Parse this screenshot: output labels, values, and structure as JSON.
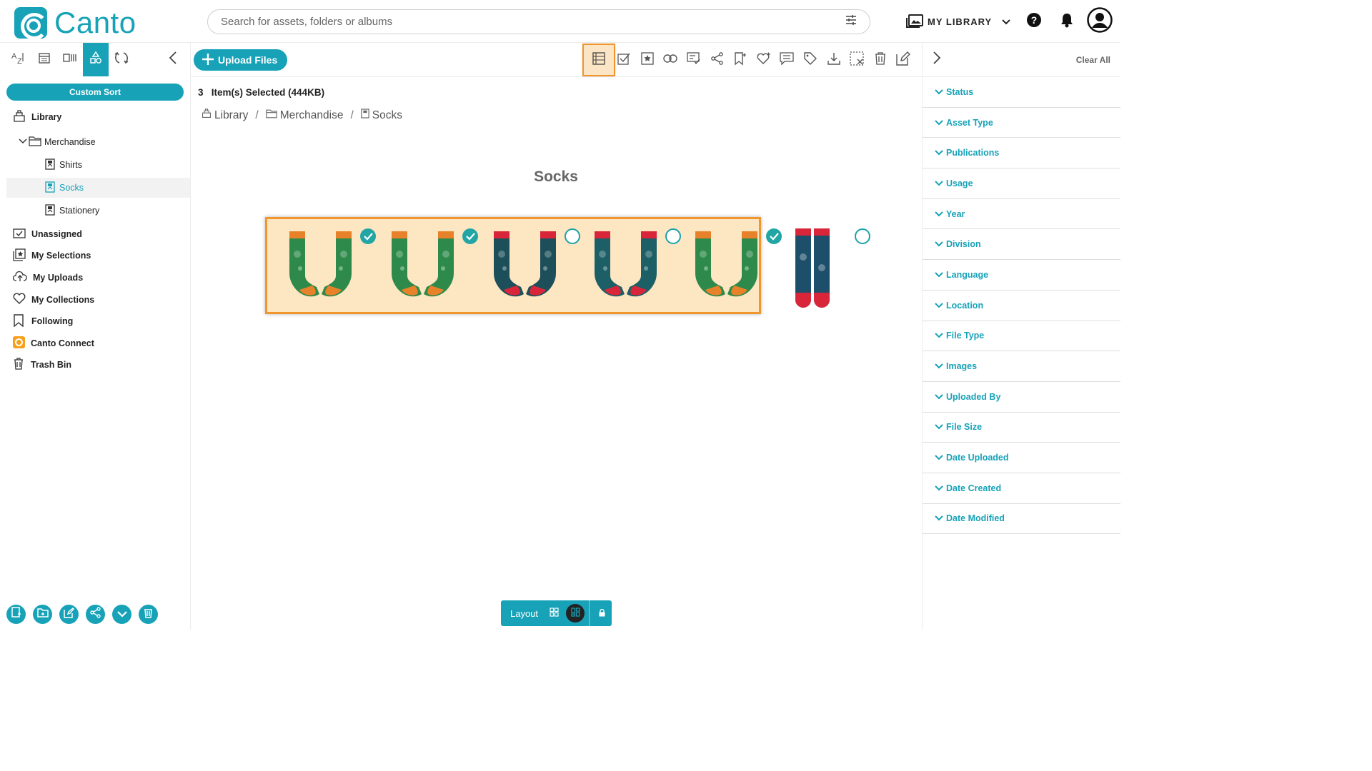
{
  "header": {
    "brand": "Canto",
    "search_placeholder": "Search for assets, folders or albums",
    "library_switch": "MY LIBRARY"
  },
  "sidebar": {
    "sort_button": "Custom Sort",
    "tree": {
      "library": "Library",
      "merchandise": "Merchandise",
      "shirts": "Shirts",
      "socks": "Socks",
      "stationery": "Stationery"
    },
    "nav": [
      {
        "label": "Unassigned",
        "icon": "unassigned-icon"
      },
      {
        "label": "My Selections",
        "icon": "selections-icon"
      },
      {
        "label": "My Uploads",
        "icon": "upload-cloud-icon"
      },
      {
        "label": "My Collections",
        "icon": "heart-icon"
      },
      {
        "label": "Following",
        "icon": "bookmark-icon"
      },
      {
        "label": "Canto Connect",
        "icon": "canto-connect-icon"
      },
      {
        "label": "Trash Bin",
        "icon": "trash-icon"
      }
    ]
  },
  "toolbar": {
    "upload_label": "Upload Files"
  },
  "main": {
    "selection_count": "3",
    "selection_text": "Item(s) Selected (444KB)",
    "breadcrumb": [
      "Library",
      "Merchandise",
      "Socks"
    ],
    "folder_title": "Socks",
    "assets": [
      {
        "id": "sock-1",
        "selected": true,
        "palette": [
          "#2e8a4a",
          "#e8822a"
        ]
      },
      {
        "id": "sock-2",
        "selected": true,
        "palette": [
          "#2e8a4a",
          "#e8822a"
        ]
      },
      {
        "id": "sock-3",
        "selected": false,
        "palette": [
          "#1d4f5a",
          "#d9253a"
        ]
      },
      {
        "id": "sock-4",
        "selected": false,
        "palette": [
          "#1d5f66",
          "#d9253a"
        ]
      },
      {
        "id": "sock-5",
        "selected": true,
        "palette": [
          "#2e8a4a",
          "#e8822a"
        ]
      },
      {
        "id": "sock-6",
        "selected": false,
        "palette": [
          "#1d4f6a",
          "#d9253a"
        ]
      }
    ]
  },
  "layout_bar": {
    "label": "Layout"
  },
  "filters": {
    "clear_all": "Clear All",
    "items": [
      "Status",
      "Asset Type",
      "Publications",
      "Usage",
      "Year",
      "Division",
      "Language",
      "Location",
      "File Type",
      "Images",
      "Uploaded By",
      "File Size",
      "Date Uploaded",
      "Date Created",
      "Date Modified"
    ]
  },
  "colors": {
    "accent": "#17a2b8",
    "highlight": "#f0962e"
  }
}
